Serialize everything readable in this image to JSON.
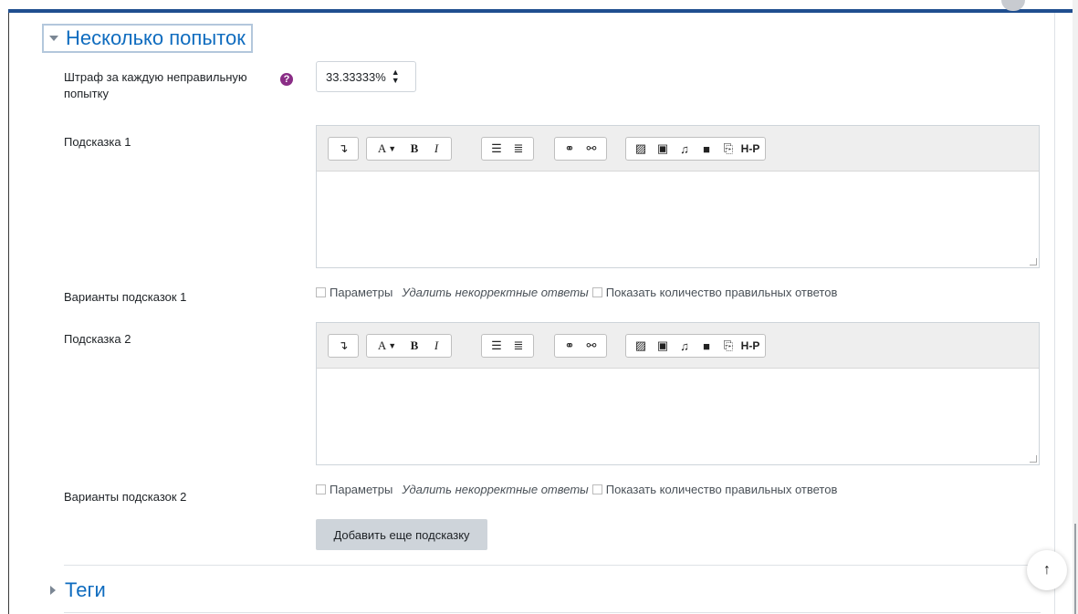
{
  "section": {
    "title": "Несколько попыток"
  },
  "penalty": {
    "label": "Штраф за каждую неправильную попытку",
    "value": "33.33333%",
    "help_icon": "question-circle-icon"
  },
  "hints": [
    {
      "label": "Подсказка 1",
      "options_label": "Варианты подсказок 1"
    },
    {
      "label": "Подсказка 2",
      "options_label": "Варианты подсказок 2"
    }
  ],
  "editor_toolbar": {
    "icons": [
      "collapse-toggle-icon",
      "font-color-icon",
      "bold-icon",
      "italic-icon",
      "unordered-list-icon",
      "ordered-list-icon",
      "link-icon",
      "unlink-icon",
      "image-icon",
      "media-icon",
      "record-audio-icon",
      "record-video-icon",
      "manage-files-icon",
      "h5p-icon"
    ],
    "bold_glyph": "B",
    "italic_glyph": "I",
    "font_glyph": "A",
    "h5p_text": "H-P"
  },
  "hint_options": {
    "params": "Параметры",
    "remove_incorrect": "Удалить некорректные ответы",
    "show_count": "Показать количество правильных ответов"
  },
  "add_hint_button": "Добавить еще подсказку",
  "tags": {
    "title": "Теги"
  },
  "colors": {
    "accent": "#0f6cbf",
    "help": "#8a2d86",
    "top_bar": "#1f4e8f",
    "button_bg": "#ced4da"
  }
}
